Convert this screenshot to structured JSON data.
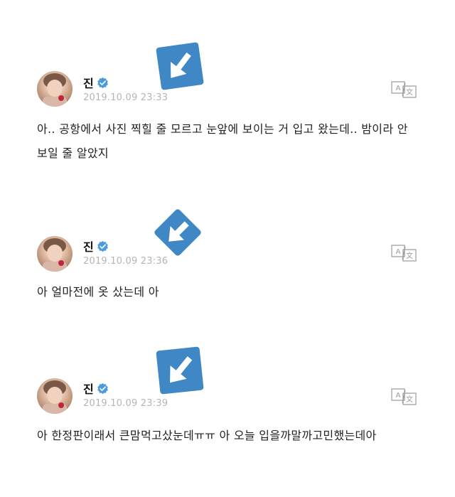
{
  "posts": [
    {
      "author": "진",
      "verified": true,
      "timestamp": "2019.10.09 23:33",
      "text_lines": [
        "아.. 공항에서 사진 찍힐 줄 모르고 눈앞에 보이는 거 입고 왔는데.. 밤이라 안",
        "보일 줄 알았지"
      ]
    },
    {
      "author": "진",
      "verified": true,
      "timestamp": "2019.10.09 23:36",
      "text_lines": [
        "아 얼마전에 옷 샀는데 아"
      ]
    },
    {
      "author": "진",
      "verified": true,
      "timestamp": "2019.10.09 23:39",
      "text_lines": [
        "아 한정판이래서 큰맘먹고샀눈데ㅠㅠ 아 오늘 입을까말까고민했는데아"
      ]
    }
  ],
  "icons": {
    "verified": "verified-badge-icon",
    "translate": "translate-icon",
    "arrow": "arrow-down-left-icon"
  },
  "colors": {
    "badge_blue": "#3f88c5",
    "verified_blue": "#4a9ae0",
    "timestamp_gray": "#b5b5b5",
    "text": "#222222"
  }
}
